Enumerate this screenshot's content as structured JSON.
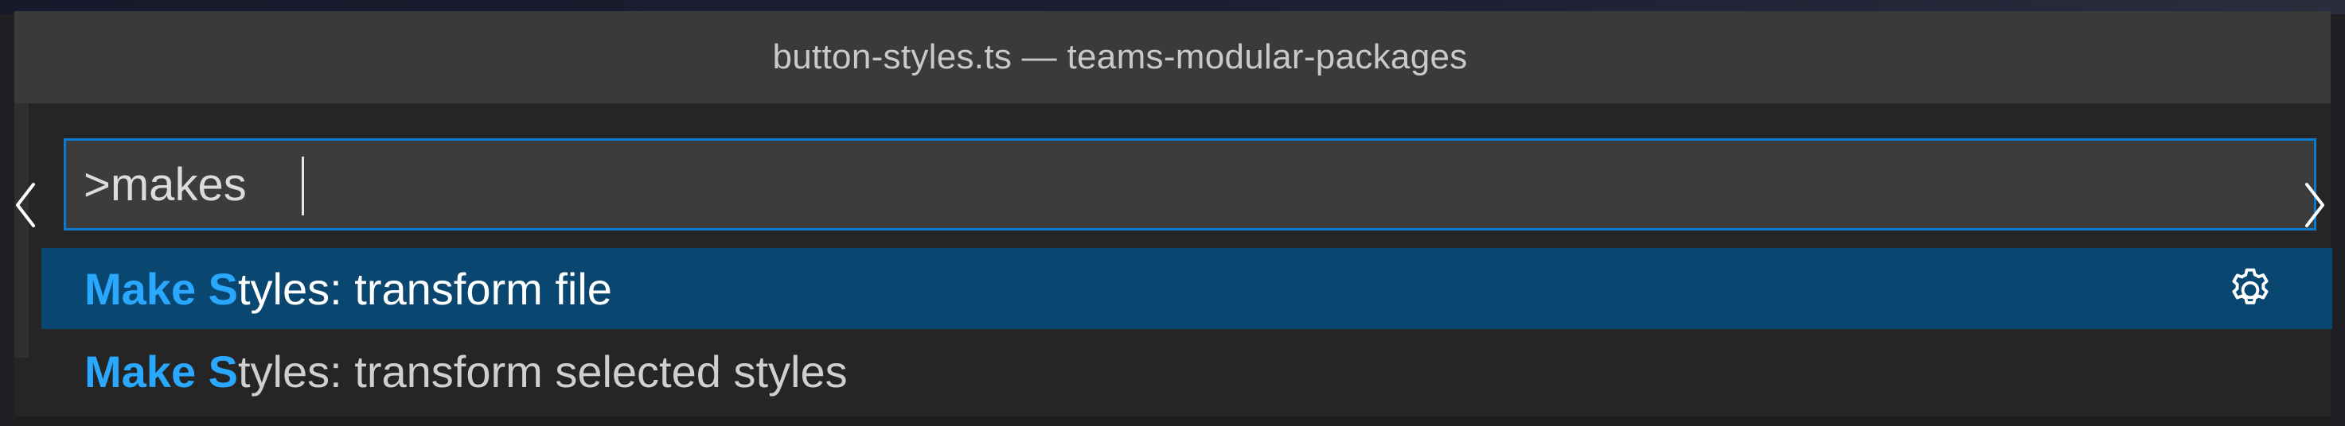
{
  "window": {
    "title": "button-styles.ts — teams-modular-packages"
  },
  "command_palette": {
    "input_value": ">makes",
    "results": [
      {
        "highlight": "Make S",
        "rest": "tyles: transform file",
        "selected": true,
        "icon": "gear-icon"
      },
      {
        "highlight": "Make S",
        "rest": "tyles: transform selected styles",
        "selected": false
      }
    ]
  },
  "colors": {
    "accent": "#0b7ad1",
    "selection": "#094771",
    "match_highlight": "#2aa8ff",
    "titlebar": "#3a3a3a",
    "panel": "#252526"
  },
  "icons": {
    "left": "chevron-left-icon",
    "right": "chevron-right-icon",
    "settings": "gear-icon"
  }
}
